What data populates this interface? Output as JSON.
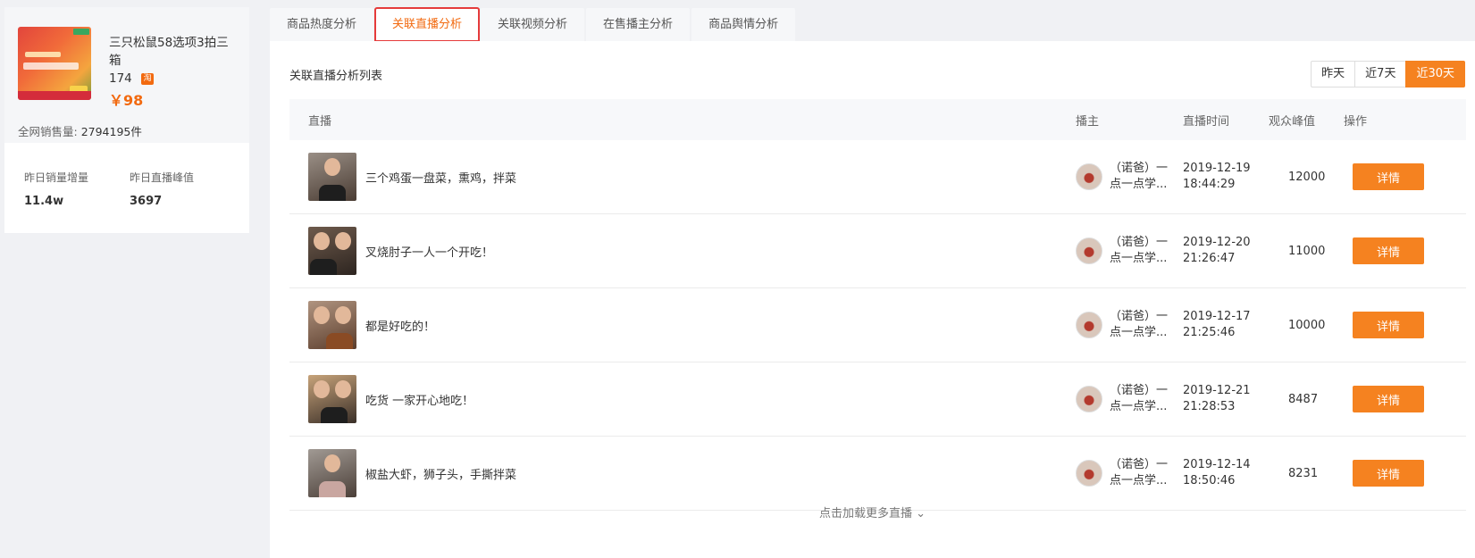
{
  "product": {
    "name_line1": "三只松鼠58选项3拍三箱",
    "name_line2": "174",
    "badge": "淘",
    "price": "￥98",
    "sales_label": "全网销售量:",
    "sales_value": "2794195件"
  },
  "stats": [
    {
      "label": "昨日销量增量",
      "value": "11.4w"
    },
    {
      "label": "昨日直播峰值",
      "value": "3697"
    }
  ],
  "tabs": [
    {
      "label": "商品热度分析",
      "active": false
    },
    {
      "label": "关联直播分析",
      "active": true
    },
    {
      "label": "关联视频分析",
      "active": false
    },
    {
      "label": "在售播主分析",
      "active": false
    },
    {
      "label": "商品舆情分析",
      "active": false
    }
  ],
  "list_title": "关联直播分析列表",
  "ranges": [
    {
      "label": "昨天",
      "active": false
    },
    {
      "label": "近7天",
      "active": false
    },
    {
      "label": "近30天",
      "active": true
    }
  ],
  "table": {
    "headers": {
      "live": "直播",
      "host": "播主",
      "time": "直播时间",
      "peak": "观众峰值",
      "op": "操作"
    },
    "rows": [
      {
        "title": "三个鸡蛋一盘菜，熏鸡，拌菜",
        "host_line1": "（诺爸）一",
        "host_line2": "点一点学...",
        "date": "2019-12-19",
        "clock": "18:44:29",
        "peak": "12000",
        "action": "详情"
      },
      {
        "title": "叉烧肘子一人一个开吃！",
        "host_line1": "（诺爸）一",
        "host_line2": "点一点学...",
        "date": "2019-12-20",
        "clock": "21:26:47",
        "peak": "11000",
        "action": "详情"
      },
      {
        "title": "都是好吃的！",
        "host_line1": "（诺爸）一",
        "host_line2": "点一点学...",
        "date": "2019-12-17",
        "clock": "21:25:46",
        "peak": "10000",
        "action": "详情"
      },
      {
        "title": "吃货 一家开心地吃！",
        "host_line1": "（诺爸）一",
        "host_line2": "点一点学...",
        "date": "2019-12-21",
        "clock": "21:28:53",
        "peak": "8487",
        "action": "详情"
      },
      {
        "title": "椒盐大虾，狮子头，手撕拌菜",
        "host_line1": "（诺爸）一",
        "host_line2": "点一点学...",
        "date": "2019-12-14",
        "clock": "18:50:46",
        "peak": "8231",
        "action": "详情"
      }
    ]
  },
  "load_more": "点击加载更多直播 ⌄"
}
